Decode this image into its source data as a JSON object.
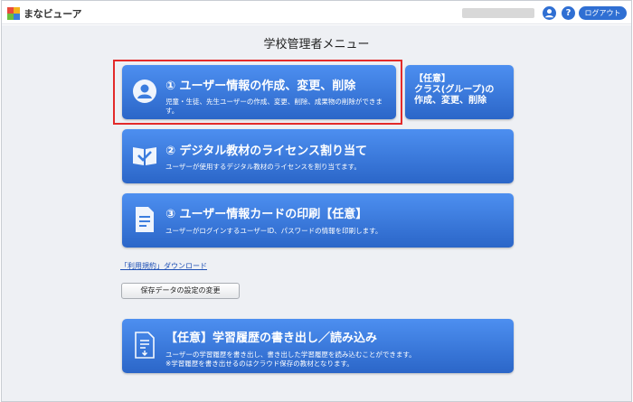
{
  "header": {
    "app_name": "まなビューア",
    "help_label": "?",
    "logout_label": "ログアウト"
  },
  "main": {
    "title": "学校管理者メニュー",
    "cards": [
      {
        "title": "① ユーザー情報の作成、変更、削除",
        "desc": "児童・生徒、先生ユーザーの作成、変更、削除、成果物の削除ができます。",
        "icon": "user-icon"
      },
      {
        "title": "② デジタル教材のライセンス割り当て",
        "desc": "ユーザーが使用するデジタル教材のライセンスを割り当てます。",
        "icon": "book-check-icon"
      },
      {
        "title": "③ ユーザー情報カードの印刷【任意】",
        "desc": "ユーザーがログインするユーザーID、パスワードの情報を印刷します。",
        "icon": "document-icon"
      }
    ],
    "class_card": {
      "line1": "【任意】",
      "line2": "クラス(グループ)の",
      "line3": "作成、変更、削除"
    },
    "terms_link": "「利用規約」ダウンロード",
    "save_settings_button": "保存データの設定の変更",
    "history_card": {
      "title": "【任意】学習履歴の書き出し／読み込み",
      "desc1": "ユーザーの学習履歴を書き出し、書き出した学習履歴を読み込むことができます。",
      "desc2": "※学習履歴を書き出せるのはクラウド保存の教材となります。",
      "icon": "export-file-icon"
    }
  },
  "colors": {
    "accent": "#2f6fd3",
    "card_top": "#4d8ff0",
    "card_bottom": "#2b66c8",
    "highlight": "#e32a2a"
  }
}
